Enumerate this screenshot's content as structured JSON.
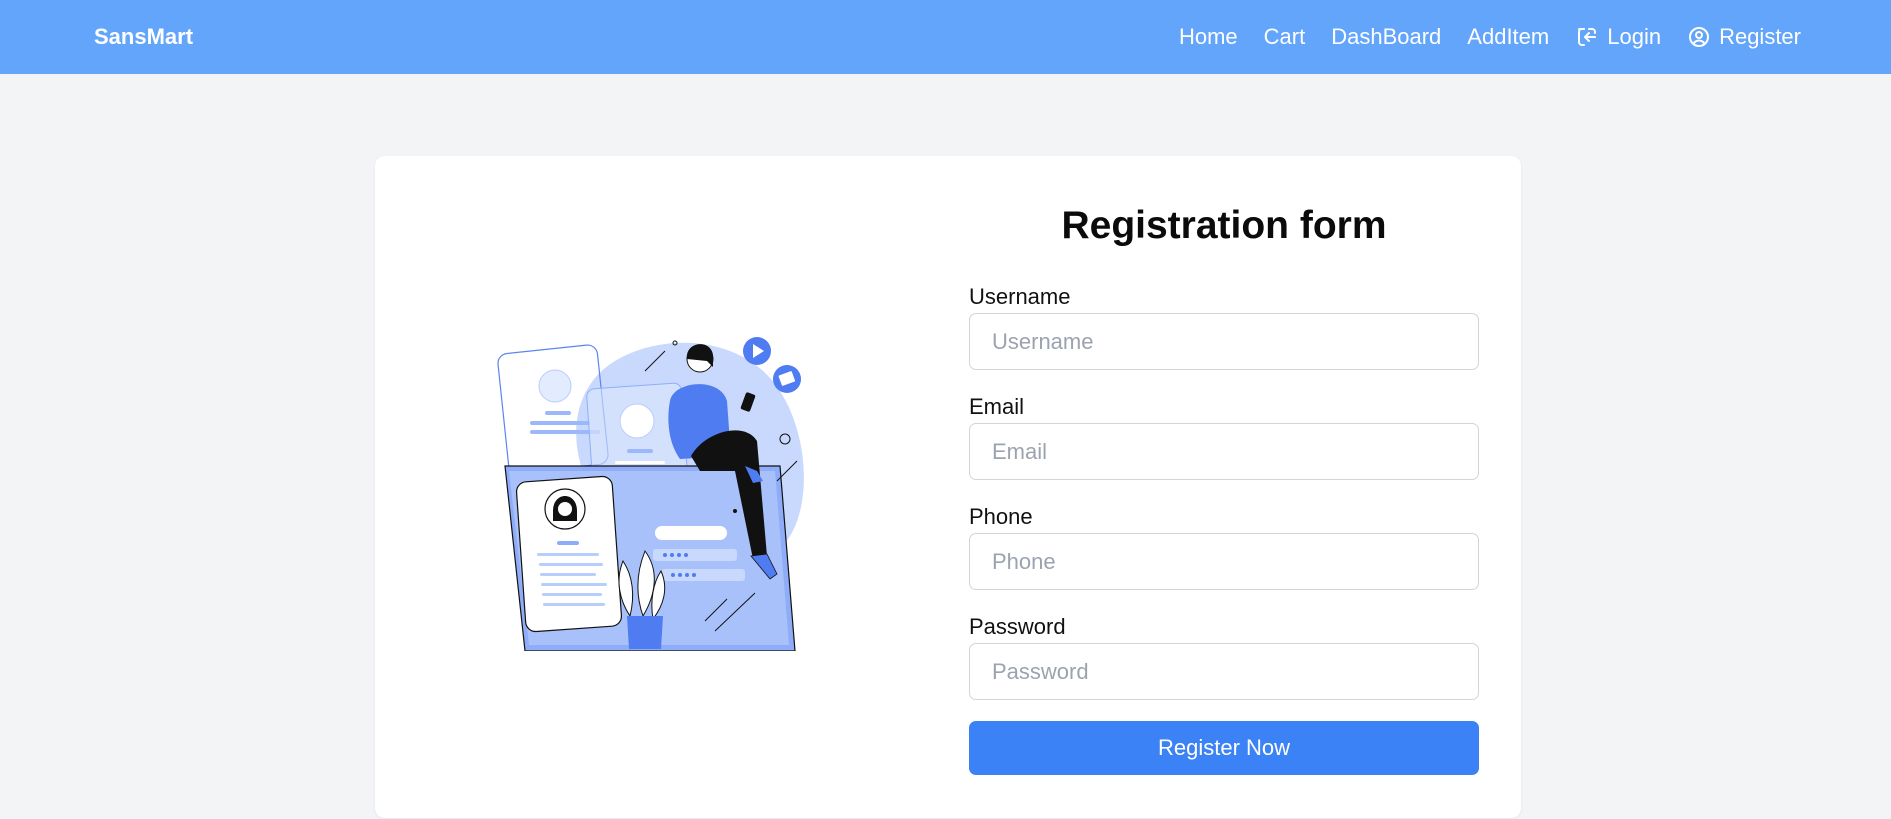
{
  "nav": {
    "brand": "SansMart",
    "links": [
      {
        "label": "Home"
      },
      {
        "label": "Cart"
      },
      {
        "label": "DashBoard"
      },
      {
        "label": "AddItem"
      },
      {
        "label": "Login",
        "icon": "login-icon"
      },
      {
        "label": "Register",
        "icon": "user-circle-icon"
      }
    ]
  },
  "form": {
    "title": "Registration form",
    "fields": [
      {
        "label": "Username",
        "placeholder": "Username",
        "value": ""
      },
      {
        "label": "Email",
        "placeholder": "Email",
        "value": ""
      },
      {
        "label": "Phone",
        "placeholder": "Phone",
        "value": ""
      },
      {
        "label": "Password",
        "placeholder": "Password",
        "value": ""
      }
    ],
    "submit_label": "Register Now"
  },
  "colors": {
    "navbar": "#62a5fa",
    "primary_button": "#3b82f6",
    "page_background": "#f3f4f6",
    "illustration_accent": "#4f7cf0",
    "illustration_light": "#b7cdfb"
  }
}
